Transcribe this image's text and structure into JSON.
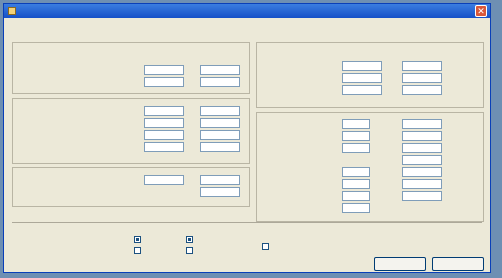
{
  "window": {
    "title": ""
  },
  "left": {
    "heading": "",
    "group1": {
      "caption": "",
      "col1": "",
      "col2": "",
      "rows": [
        {
          "label": "",
          "v1": "",
          "v2": ""
        },
        {
          "label": "",
          "v1": "",
          "v2": ""
        }
      ]
    },
    "group2": {
      "caption": "",
      "rows": [
        {
          "label": "",
          "v1": "",
          "v2": ""
        },
        {
          "label": "",
          "v1": "",
          "v2": ""
        },
        {
          "label": "",
          "v1": "",
          "v2": ""
        },
        {
          "label": "",
          "v1": "",
          "v2": ""
        }
      ]
    },
    "group3": {
      "caption": "",
      "rows": [
        {
          "label": "",
          "v1": "",
          "v2": ""
        },
        {
          "label": "",
          "v1": "",
          "v2": ""
        }
      ]
    }
  },
  "right": {
    "heading": "",
    "group1": {
      "caption": "",
      "col1": "",
      "col2": "",
      "col3": "",
      "rows": [
        {
          "label": "",
          "v1": "",
          "v3": ""
        },
        {
          "label": "",
          "v1": "",
          "v3": ""
        },
        {
          "label": "",
          "v1": "",
          "v3": ""
        }
      ]
    },
    "group2": {
      "caption": "",
      "rows": [
        {
          "label": "",
          "mid": "",
          "v1": "",
          "v3": ""
        },
        {
          "label": "",
          "mid": "",
          "v1": "",
          "v3": ""
        },
        {
          "label": "",
          "mid": "",
          "v1": "",
          "v3": ""
        },
        {
          "label": "",
          "mid": "",
          "v1": "",
          "v3": ""
        },
        {
          "label": "",
          "mid": "",
          "v1": "",
          "v3": ""
        },
        {
          "label": "",
          "mid": "",
          "v1": "",
          "v3": ""
        },
        {
          "label": "",
          "mid": "",
          "v1": "",
          "v3": ""
        },
        {
          "label": "",
          "mid": "",
          "v1": "",
          "v3": ""
        }
      ]
    }
  },
  "parameter": {
    "caption": "",
    "rows": [
      {
        "label": "",
        "opt1": "",
        "opt2": ""
      },
      {
        "label": "",
        "opt1": "",
        "opt2": ""
      }
    ]
  },
  "inventory": {
    "caption": "",
    "option": ""
  },
  "buttons": {
    "ok": "",
    "back": ""
  }
}
